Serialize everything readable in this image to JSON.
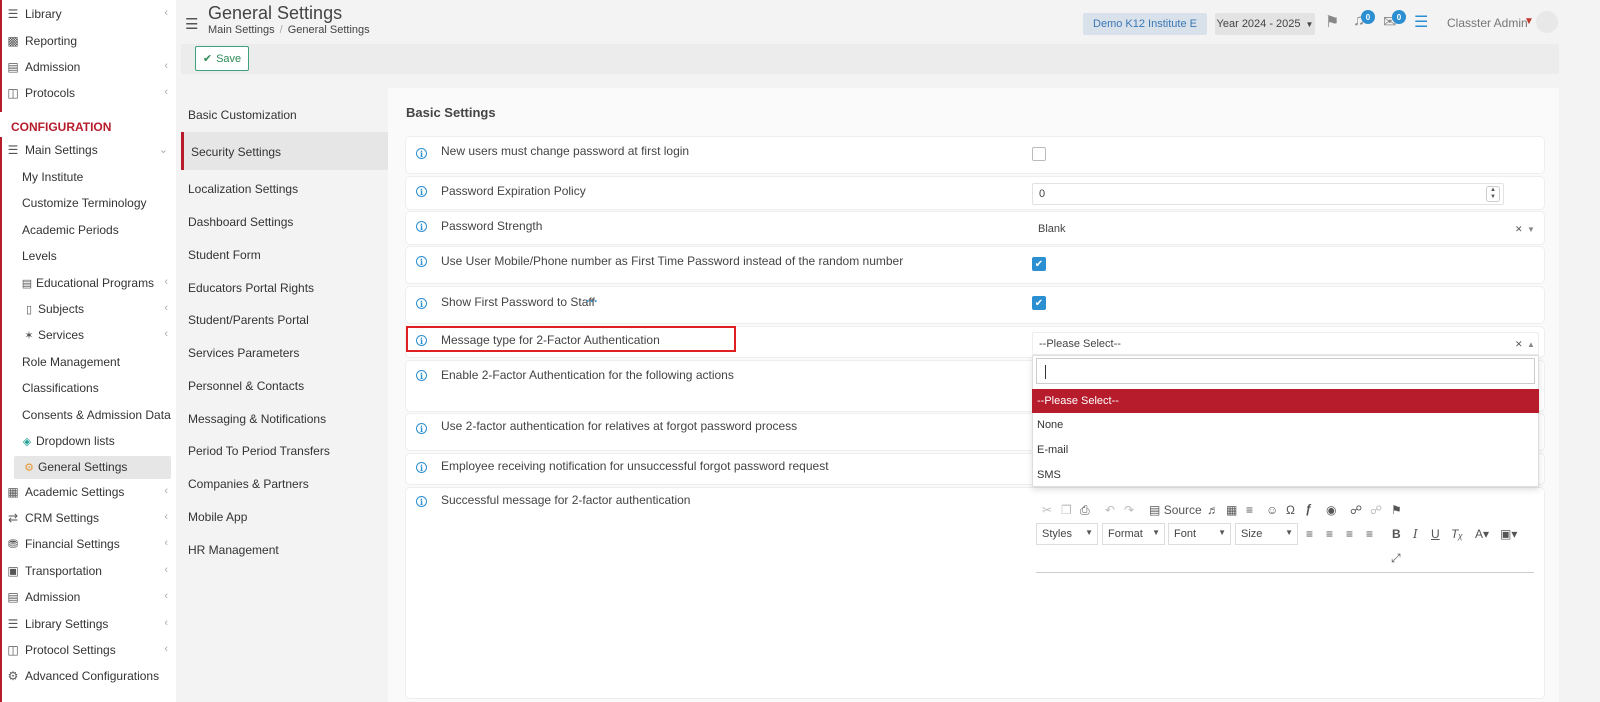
{
  "sidebar": {
    "top_items": [
      {
        "label": "Library",
        "icon": "books-icon",
        "chevron": true
      },
      {
        "label": "Reporting",
        "icon": "printer-icon",
        "chevron": false
      },
      {
        "label": "Admission",
        "icon": "institution-icon",
        "chevron": true
      },
      {
        "label": "Protocols",
        "icon": "protocol-icon",
        "chevron": true
      }
    ],
    "config_heading": "CONFIGURATION",
    "main_settings": {
      "label": "Main Settings",
      "icon": "sliders-icon"
    },
    "sub_items": [
      {
        "label": "My Institute",
        "icon": "",
        "chevron": false
      },
      {
        "label": "Customize Terminology",
        "icon": "",
        "chevron": false
      },
      {
        "label": "Academic Periods",
        "icon": "",
        "chevron": false
      },
      {
        "label": "Levels",
        "icon": "",
        "chevron": false
      },
      {
        "label": "Educational Programs",
        "icon": "table-icon",
        "chevron": true
      },
      {
        "label": "Subjects",
        "icon": "book-icon",
        "chevron": true
      },
      {
        "label": "Services",
        "icon": "nodes-icon",
        "chevron": true
      },
      {
        "label": "Role Management",
        "icon": "",
        "chevron": false
      },
      {
        "label": "Classifications",
        "icon": "",
        "chevron": false
      },
      {
        "label": "Consents & Admission Data",
        "icon": "",
        "chevron": false
      },
      {
        "label": "Dropdown lists",
        "icon": "layers-icon",
        "chevron": false
      },
      {
        "label": "General Settings",
        "icon": "gear-icon",
        "chevron": false
      }
    ],
    "bottom_items": [
      {
        "label": "Academic Settings",
        "icon": "org-chart-icon",
        "chevron": true
      },
      {
        "label": "CRM Settings",
        "icon": "shuffle-icon",
        "chevron": true
      },
      {
        "label": "Financial Settings",
        "icon": "coins-icon",
        "chevron": true
      },
      {
        "label": "Transportation",
        "icon": "bus-icon",
        "chevron": true
      },
      {
        "label": "Admission",
        "icon": "institution-icon",
        "chevron": true
      },
      {
        "label": "Library Settings",
        "icon": "books-icon",
        "chevron": true
      },
      {
        "label": "Protocol Settings",
        "icon": "protocol-icon",
        "chevron": true
      },
      {
        "label": "Advanced Configurations",
        "icon": "gears-icon",
        "chevron": false
      }
    ]
  },
  "header": {
    "title": "General Settings",
    "breadcrumb": [
      "Main Settings",
      "General Settings"
    ],
    "institute": "Demo K12 Institute E",
    "year": "Year 2024 - 2025",
    "notifications_count": "0",
    "messages_count": "0",
    "user": "Classter Admin"
  },
  "toolbar": {
    "save_label": "Save"
  },
  "settings_menu": [
    "Basic Customization",
    "Security Settings",
    "Localization Settings",
    "Dashboard Settings",
    "Student Form",
    "Educators Portal Rights",
    "Student/Parents Portal",
    "Services Parameters",
    "Personnel & Contacts",
    "Messaging & Notifications",
    "Period To Period Transfers",
    "Companies & Partners",
    "Mobile App",
    "HR Management"
  ],
  "content": {
    "heading": "Basic Settings",
    "rows": [
      {
        "label": "New users must change password at first login",
        "type": "checkbox",
        "checked": false
      },
      {
        "label": "Password Expiration Policy",
        "type": "number",
        "value": "0"
      },
      {
        "label": "Password Strength",
        "type": "select",
        "value": "Blank"
      },
      {
        "label": "Use User Mobile/Phone number as First Time Password instead of the random number",
        "type": "checkbox",
        "checked": true
      },
      {
        "label": "Show First Password to Staff",
        "type": "checkbox",
        "checked": true,
        "more": "···"
      },
      {
        "label": "Message type for 2-Factor Authentication",
        "type": "select",
        "value": "--Please Select--"
      },
      {
        "label": "Enable 2-Factor Authentication for the following actions",
        "type": "multiselect"
      },
      {
        "label": "Use 2-factor authentication for relatives at forgot password process",
        "type": "checkbox"
      },
      {
        "label": "Employee receiving notification for unsuccessful forgot password request",
        "type": "select"
      },
      {
        "label": "Successful message for 2-factor authentication",
        "type": "editor"
      }
    ]
  },
  "dropdown": {
    "search_value": "",
    "options": [
      "--Please Select--",
      "None",
      "E-mail",
      "SMS"
    ],
    "selected_index": 0
  },
  "editor": {
    "source_label": "Source",
    "combos": [
      "Styles",
      "Format",
      "Font",
      "Size"
    ]
  },
  "colors": {
    "accent": "#b71c2c",
    "primary": "#2b8fd1",
    "save_green": "#2e8b57"
  }
}
